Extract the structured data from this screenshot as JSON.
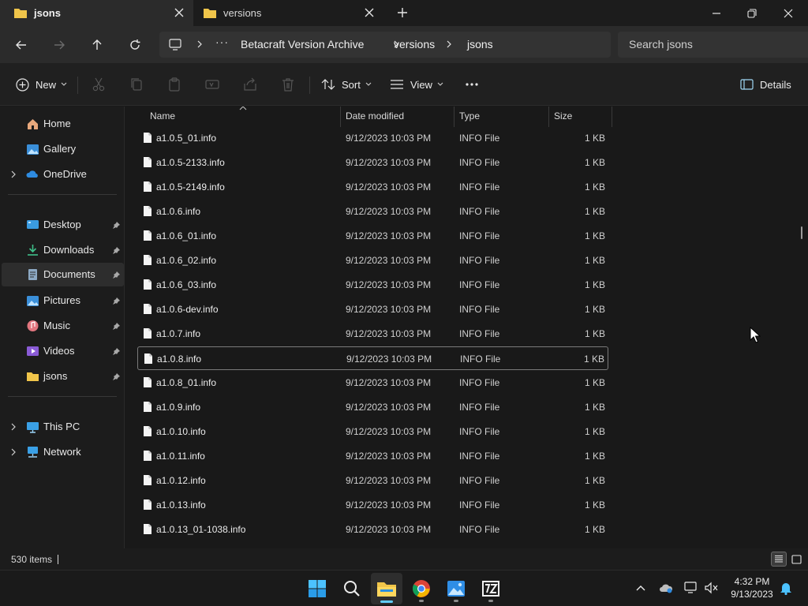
{
  "window": {
    "tabs": [
      {
        "label": "jsons",
        "active": true
      },
      {
        "label": "versions",
        "active": false
      }
    ]
  },
  "address": {
    "crumbs": [
      "Betacraft Version Archive",
      "versions",
      "jsons"
    ],
    "search_placeholder": "Search jsons"
  },
  "toolbar": {
    "new_label": "New",
    "sort_label": "Sort",
    "view_label": "View",
    "details_label": "Details"
  },
  "sidebar": {
    "items": [
      {
        "label": "Home",
        "icon": "home-icon"
      },
      {
        "label": "Gallery",
        "icon": "gallery-icon"
      },
      {
        "label": "OneDrive",
        "icon": "onedrive-icon"
      },
      {
        "label": "Desktop",
        "icon": "desktop-icon"
      },
      {
        "label": "Downloads",
        "icon": "downloads-icon"
      },
      {
        "label": "Documents",
        "icon": "documents-icon"
      },
      {
        "label": "Pictures",
        "icon": "pictures-icon"
      },
      {
        "label": "Music",
        "icon": "music-icon"
      },
      {
        "label": "Videos",
        "icon": "videos-icon"
      },
      {
        "label": "jsons",
        "icon": "folder-icon"
      },
      {
        "label": "This PC",
        "icon": "this-pc-icon"
      },
      {
        "label": "Network",
        "icon": "network-icon"
      }
    ]
  },
  "columns": {
    "name": "Name",
    "date": "Date modified",
    "type": "Type",
    "size": "Size"
  },
  "files": [
    {
      "name": "a1.0.5_01.info",
      "date": "9/12/2023 10:03 PM",
      "type": "INFO File",
      "size": "1 KB"
    },
    {
      "name": "a1.0.5-2133.info",
      "date": "9/12/2023 10:03 PM",
      "type": "INFO File",
      "size": "1 KB"
    },
    {
      "name": "a1.0.5-2149.info",
      "date": "9/12/2023 10:03 PM",
      "type": "INFO File",
      "size": "1 KB"
    },
    {
      "name": "a1.0.6.info",
      "date": "9/12/2023 10:03 PM",
      "type": "INFO File",
      "size": "1 KB"
    },
    {
      "name": "a1.0.6_01.info",
      "date": "9/12/2023 10:03 PM",
      "type": "INFO File",
      "size": "1 KB"
    },
    {
      "name": "a1.0.6_02.info",
      "date": "9/12/2023 10:03 PM",
      "type": "INFO File",
      "size": "1 KB"
    },
    {
      "name": "a1.0.6_03.info",
      "date": "9/12/2023 10:03 PM",
      "type": "INFO File",
      "size": "1 KB"
    },
    {
      "name": "a1.0.6-dev.info",
      "date": "9/12/2023 10:03 PM",
      "type": "INFO File",
      "size": "1 KB"
    },
    {
      "name": "a1.0.7.info",
      "date": "9/12/2023 10:03 PM",
      "type": "INFO File",
      "size": "1 KB"
    },
    {
      "name": "a1.0.8.info",
      "date": "9/12/2023 10:03 PM",
      "type": "INFO File",
      "size": "1 KB"
    },
    {
      "name": "a1.0.8_01.info",
      "date": "9/12/2023 10:03 PM",
      "type": "INFO File",
      "size": "1 KB"
    },
    {
      "name": "a1.0.9.info",
      "date": "9/12/2023 10:03 PM",
      "type": "INFO File",
      "size": "1 KB"
    },
    {
      "name": "a1.0.10.info",
      "date": "9/12/2023 10:03 PM",
      "type": "INFO File",
      "size": "1 KB"
    },
    {
      "name": "a1.0.11.info",
      "date": "9/12/2023 10:03 PM",
      "type": "INFO File",
      "size": "1 KB"
    },
    {
      "name": "a1.0.12.info",
      "date": "9/12/2023 10:03 PM",
      "type": "INFO File",
      "size": "1 KB"
    },
    {
      "name": "a1.0.13.info",
      "date": "9/12/2023 10:03 PM",
      "type": "INFO File",
      "size": "1 KB"
    },
    {
      "name": "a1.0.13_01-1038.info",
      "date": "9/12/2023 10:03 PM",
      "type": "INFO File",
      "size": "1 KB"
    }
  ],
  "status": {
    "item_count": "530 items"
  },
  "clock": {
    "time": "4:32 PM",
    "date": "9/13/2023"
  },
  "colors": {
    "accent": "#60cdff",
    "folder": "#f0c54a",
    "background": "#191919"
  }
}
